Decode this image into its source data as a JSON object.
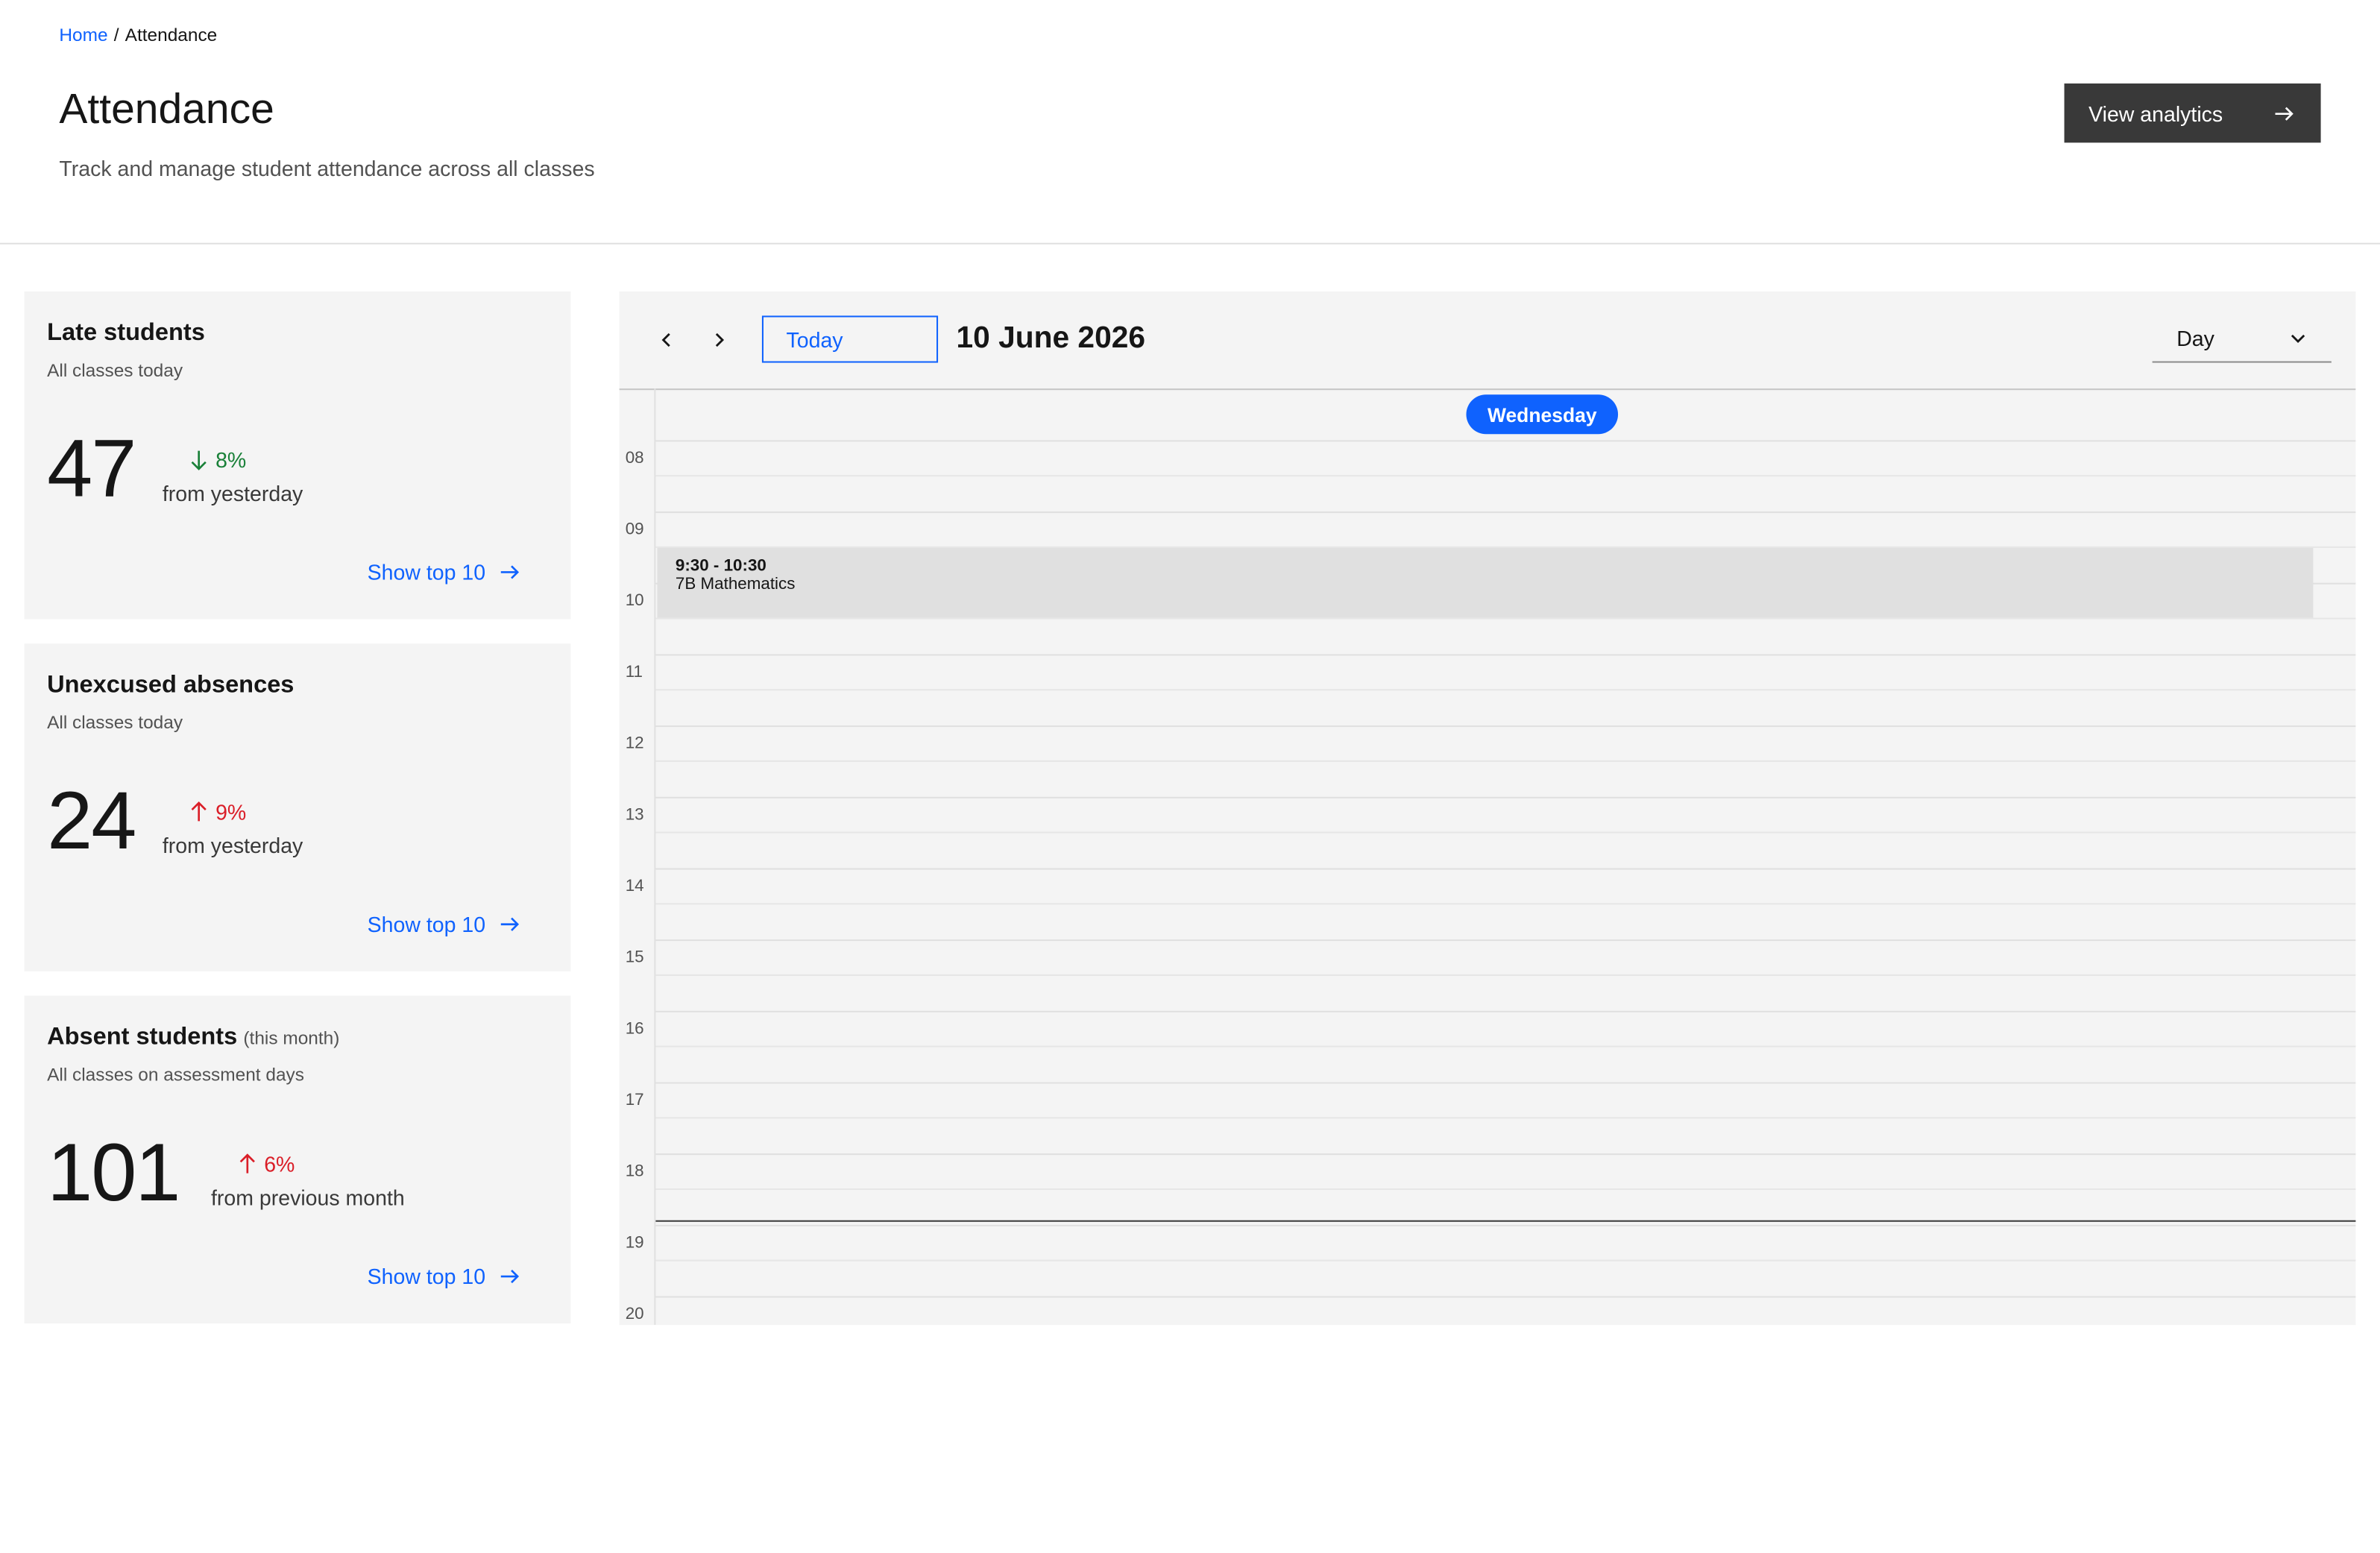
{
  "breadcrumb": {
    "home": "Home",
    "separator": "/",
    "current": "Attendance"
  },
  "header": {
    "title": "Attendance",
    "subtitle": "Track and manage student attendance across all classes",
    "analytics_label": "View analytics"
  },
  "cards": [
    {
      "title": "Late students",
      "note": "",
      "subtitle": "All classes today",
      "value": "47",
      "trend": "8%",
      "trend_direction": "down",
      "trend_caption": "from yesterday",
      "link": "Show top 10"
    },
    {
      "title": "Unexcused absences",
      "note": "",
      "subtitle": "All classes today",
      "value": "24",
      "trend": "9%",
      "trend_direction": "up",
      "trend_caption": "from yesterday",
      "link": "Show top 10"
    },
    {
      "title": "Absent students",
      "note": "(this month)",
      "subtitle": "All classes on assessment days",
      "value": "101",
      "trend": "6%",
      "trend_direction": "up",
      "trend_caption": "from previous month",
      "link": "Show top 10"
    }
  ],
  "calendar": {
    "today_label": "Today",
    "date": "10 June 2026",
    "view": "Day",
    "weekday": "Wednesday",
    "hours": [
      "08",
      "09",
      "10",
      "11",
      "12",
      "13",
      "14",
      "15",
      "16",
      "17",
      "18",
      "19",
      "20"
    ],
    "event": {
      "time": "9:30 - 10:30",
      "title": "7B Mathematics"
    }
  },
  "colors": {
    "accent": "#0f62fe",
    "trend_down": "#198038",
    "trend_up": "#da1e28",
    "button_dark": "#393939",
    "card_bg": "#f4f4f4"
  },
  "icons": [
    "arrow-right-icon",
    "arrow-down-icon",
    "arrow-up-icon",
    "chevron-left-icon",
    "chevron-right-icon",
    "chevron-down-icon"
  ]
}
